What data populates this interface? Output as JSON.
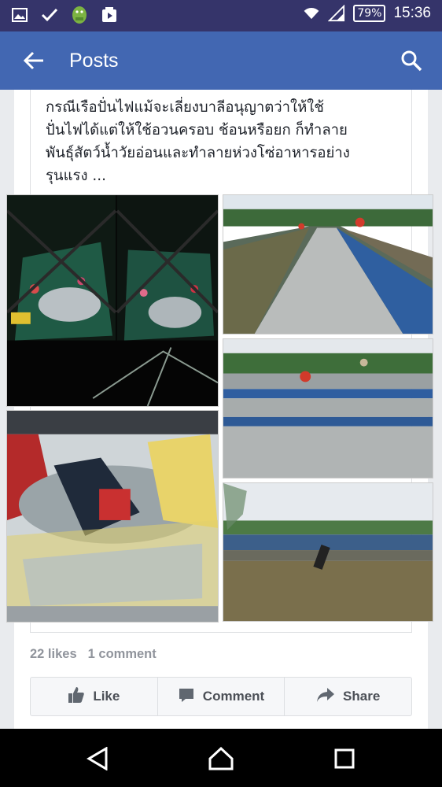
{
  "status_bar": {
    "battery": "79%",
    "time": "15:36",
    "icons": [
      "gallery-icon",
      "check-icon",
      "android-icon",
      "media-icon",
      "wifi-icon",
      "signal-icon",
      "battery-icon"
    ]
  },
  "app_bar": {
    "title": "Posts",
    "icons": [
      "back-arrow-icon",
      "search-icon"
    ]
  },
  "post": {
    "text_lines": [
      "กรณีเรือปั่นไฟแม้จะเลี่ยงบาลีอนุญาตว่าให้ใช้",
      "ปั่นไฟได้แต่ให้ใช้อวนครอบ ช้อนหรือยก ก็ทำลาย",
      "พันธุ์สัตว์น้ำวัยอ่อนและทำลายห่วงโซ่อาหารอย่าง",
      "รุนแรง ..."
    ],
    "photos": [
      "fishing-boat-night-photo",
      "fish-drying-racks-photo",
      "fish-drying-racks-workers-photo",
      "fish-drying-field-photo",
      "fish-net-catch-photo"
    ]
  },
  "stats": {
    "likes": "22 likes",
    "comments": "1 comment"
  },
  "actions": {
    "like": "Like",
    "comment": "Comment",
    "share": "Share"
  },
  "nav_bar": {
    "icons": [
      "nav-back-icon",
      "nav-home-icon",
      "nav-recents-icon"
    ]
  },
  "colors": {
    "status_bar": "#35346a",
    "app_bar": "#4267b2",
    "background": "#e9ebee",
    "text": "#1d2129",
    "muted": "#90949c"
  }
}
